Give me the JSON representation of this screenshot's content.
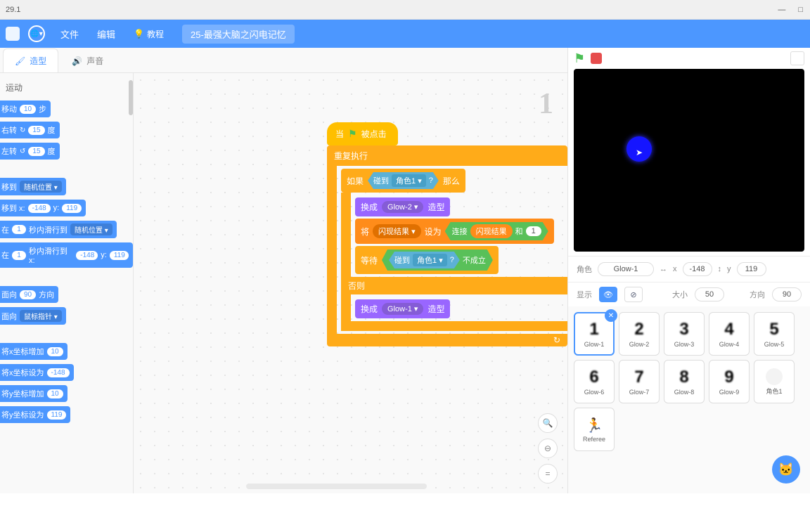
{
  "titlebar": {
    "version": "29.1",
    "min": "—",
    "max": "□",
    "close": "✕"
  },
  "menubar": {
    "file": "文件",
    "edit": "编辑",
    "tutorial": "教程",
    "project": "25-最强大脑之闪电记忆"
  },
  "tabs": {
    "costume": "造型",
    "sound": "声音"
  },
  "palette": {
    "category": "运动",
    "blocks": {
      "move": "移动",
      "steps": "步",
      "val10": "10",
      "turn_right": "右转",
      "turn_left": "左转",
      "deg": "度",
      "val15": "15",
      "goto": "移到",
      "random": "随机位置 ▾",
      "gotoxy": "移到 x:",
      "y": "y:",
      "xval": "-148",
      "yval": "119",
      "glide": "在",
      "sec": "秒内滑行到",
      "val1": "1",
      "glidexy": "秒内滑行到 x:",
      "point": "面向",
      "dir": "方向",
      "val90": "90",
      "point_towards": "面向",
      "mouse": "鼠标指针 ▾",
      "changex": "将x坐标增加",
      "setx": "将x坐标设为",
      "setxval": "-148",
      "changey": "将y坐标增加",
      "sety": "将y坐标设为",
      "setyval": "119"
    }
  },
  "script": {
    "hat": "被点击",
    "when": "当",
    "forever": "重复执行",
    "if": "如果",
    "then": "那么",
    "else": "否则",
    "touching": "碰到",
    "sprite1": "角色1 ▾",
    "q": "?",
    "switch": "换成",
    "costume_suffix": "造型",
    "glow2": "Glow-2 ▾",
    "glow1": "Glow-1 ▾",
    "set": "将",
    "var": "闪现结果 ▾",
    "setto": "设为",
    "join": "连接",
    "joinvar": "闪现结果",
    "and": "和",
    "one": "1",
    "wait": "等待",
    "not": "不成立"
  },
  "watermark": "1",
  "stage": {
    "flag": "⚑",
    "layout": "◫"
  },
  "spriteinfo": {
    "sprite_lbl": "角色",
    "name": "Glow-1",
    "x_lbl": "x",
    "x": "-148",
    "y_lbl": "y",
    "y": "119",
    "xicon": "↔",
    "yicon": "↕",
    "show_lbl": "显示",
    "size_lbl": "大小",
    "size": "50",
    "dir_lbl": "方向",
    "dir": "90"
  },
  "sprites": [
    {
      "name": "Glow-1",
      "g": "1",
      "sel": true
    },
    {
      "name": "Glow-2",
      "g": "2"
    },
    {
      "name": "Glow-3",
      "g": "3"
    },
    {
      "name": "Glow-4",
      "g": "4"
    },
    {
      "name": "Glow-5",
      "g": "5"
    },
    {
      "name": "Glow-6",
      "g": "6"
    },
    {
      "name": "Glow-7",
      "g": "7"
    },
    {
      "name": "Glow-8",
      "g": "8"
    },
    {
      "name": "Glow-9",
      "g": "9"
    },
    {
      "name": "角色1",
      "circle": true
    },
    {
      "name": "Referee",
      "ref": true
    }
  ],
  "fab": "🐱"
}
